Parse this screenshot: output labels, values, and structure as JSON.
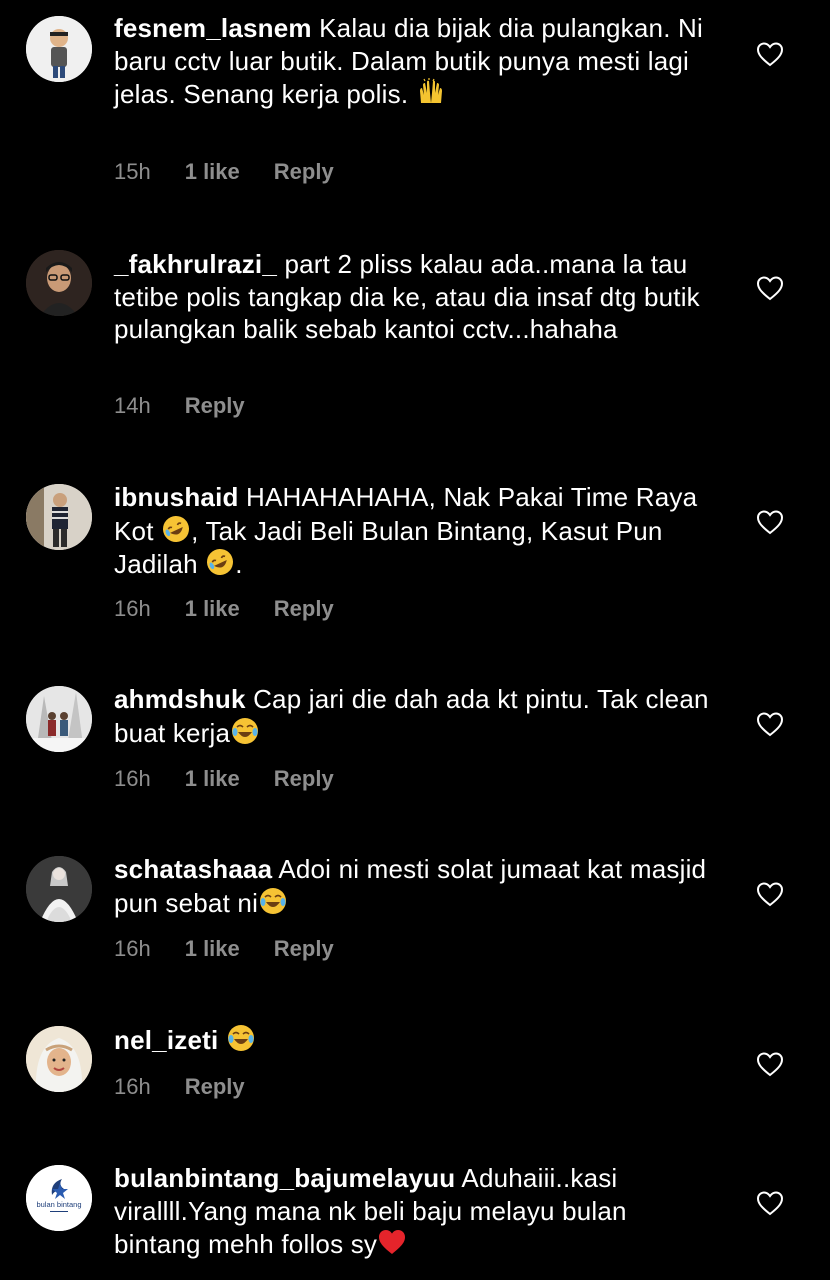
{
  "colors": {
    "background": "#000000",
    "text": "#ffffff",
    "meta": "#8e8e8e"
  },
  "comments": [
    {
      "username": "fesnem_lasnem",
      "text": "Kalau dia bijak dia pulangkan. Ni baru cctv luar butik. Dalam butik punya mesti lagi jelas. Senang kerja polis.",
      "emoji": "raising-hands-icon",
      "time": "15h",
      "likes": "1 like",
      "reply": "Reply",
      "avatar": "cartoon-avatar"
    },
    {
      "username": "_fakhrulrazi_",
      "text": "part 2 pliss kalau ada..mana la tau tetibe polis tangkap dia ke, atau dia insaf dtg butik pulangkan balik sebab kantoi cctv...hahaha",
      "time": "14h",
      "reply": "Reply",
      "avatar": "man-glasses-avatar"
    },
    {
      "username": "ibnushaid",
      "text_part1": "HAHAHAHAHA, Nak Pakai Time Raya Kot",
      "text_part2": ", Tak Jadi Beli Bulan Bintang, Kasut Pun Jadilah",
      "text_part3": ".",
      "emoji": "rolling-laughing-icon",
      "time": "16h",
      "likes": "1 like",
      "reply": "Reply",
      "avatar": "person-standing-avatar"
    },
    {
      "username": "ahmdshuk",
      "text": "Cap jari die dah ada kt pintu. Tak clean buat kerja",
      "emoji": "tears-of-joy-icon",
      "time": "16h",
      "likes": "1 like",
      "reply": "Reply",
      "avatar": "couple-avatar"
    },
    {
      "username": "schatashaaa",
      "text": "Adoi ni mesti solat jumaat kat masjid pun sebat ni",
      "emoji": "tears-of-joy-icon",
      "time": "16h",
      "likes": "1 like",
      "reply": "Reply",
      "avatar": "bride-avatar"
    },
    {
      "username": "nel_izeti",
      "text": "",
      "emoji": "tears-of-joy-icon",
      "time": "16h",
      "reply": "Reply",
      "avatar": "hijab-woman-avatar"
    },
    {
      "username": "bulanbintang_bajumelayuu",
      "text": "Aduhaiii..kasi virallll.Yang mana nk beli baju melayu bulan bintang mehh follos sy",
      "emoji": "red-heart-icon",
      "avatar": "bulan-bintang-logo-avatar",
      "avatar_logo_text": "bulan bintang"
    }
  ]
}
